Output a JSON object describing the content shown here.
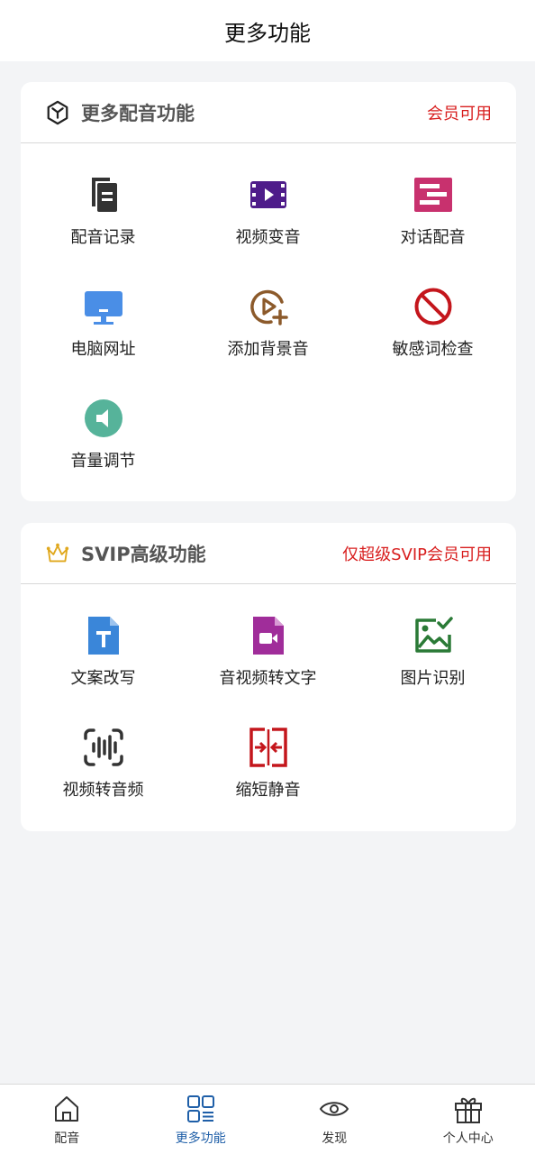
{
  "header": {
    "title": "更多功能"
  },
  "section1": {
    "title": "更多配音功能",
    "link": "会员可用",
    "icon": "cube-icon",
    "items": [
      {
        "label": "配音记录",
        "icon": "documents-icon",
        "color": "#333333"
      },
      {
        "label": "视频变音",
        "icon": "video-film-icon",
        "color": "#4e1c8a"
      },
      {
        "label": "对话配音",
        "icon": "dialogue-icon",
        "color": "#c8316e"
      },
      {
        "label": "电脑网址",
        "icon": "monitor-icon",
        "color": "#4a8ee6"
      },
      {
        "label": "添加背景音",
        "icon": "play-add-icon",
        "color": "#8c5a2b"
      },
      {
        "label": "敏感词检查",
        "icon": "prohibited-icon",
        "color": "#c4161c"
      },
      {
        "label": "音量调节",
        "icon": "volume-icon",
        "color": "#56b39a"
      }
    ]
  },
  "section2": {
    "title": "SVIP高级功能",
    "link": "仅超级SVIP会员可用",
    "icon": "crown-icon",
    "items": [
      {
        "label": "文案改写",
        "icon": "text-file-icon",
        "color": "#3a86d9"
      },
      {
        "label": "音视频转文字",
        "icon": "video-file-icon",
        "color": "#a02d9a"
      },
      {
        "label": "图片识别",
        "icon": "image-check-icon",
        "color": "#2a7a36"
      },
      {
        "label": "视频转音频",
        "icon": "audio-wave-icon",
        "color": "#333333"
      },
      {
        "label": "缩短静音",
        "icon": "compress-icon",
        "color": "#c4161c"
      }
    ]
  },
  "tabbar": {
    "active_color": "#1f5fa8",
    "tabs": [
      {
        "label": "配音",
        "icon": "home-icon"
      },
      {
        "label": "更多功能",
        "icon": "grid-menu-icon"
      },
      {
        "label": "发现",
        "icon": "eye-icon"
      },
      {
        "label": "个人中心",
        "icon": "gift-icon"
      }
    ]
  }
}
